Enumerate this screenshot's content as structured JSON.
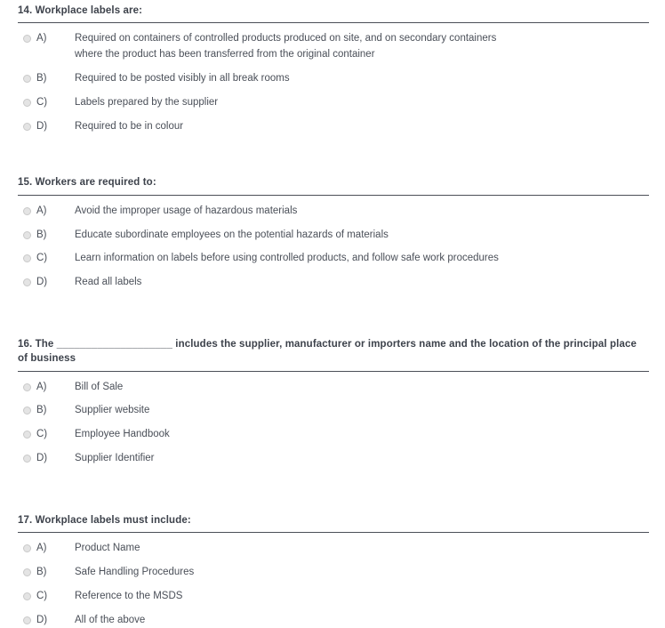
{
  "page": {
    "background": "#ffffff",
    "text_color": "#4a4f58",
    "heading_color": "#3d424b",
    "rule_color": "#4b4f57",
    "radio_fill": "#e4e4e4"
  },
  "questions": [
    {
      "number": "14.",
      "heading": "Workplace labels are:",
      "heading_full": "14.  Workplace labels are:",
      "options": [
        {
          "letter": "A)",
          "text": "Required on containers of controlled products produced on site, and on secondary containers",
          "text_line2": "where the product has been transferred from the original container"
        },
        {
          "letter": "B)",
          "text": "Required to be posted visibly in all break rooms",
          "text_line2": ""
        },
        {
          "letter": "C)",
          "text": "Labels prepared by the supplier",
          "text_line2": ""
        },
        {
          "letter": "D)",
          "text": "Required to be in colour",
          "text_line2": ""
        }
      ]
    },
    {
      "number": "15.",
      "heading": "Workers are required to:",
      "heading_full": "15.  Workers are required to:",
      "options": [
        {
          "letter": "A)",
          "text": "Avoid the improper usage of hazardous materials",
          "text_line2": ""
        },
        {
          "letter": "B)",
          "text": "Educate subordinate employees on the potential hazards of materials",
          "text_line2": ""
        },
        {
          "letter": "C)",
          "text": "Learn information on labels before using controlled products, and follow safe work procedures",
          "text_line2": ""
        },
        {
          "letter": "D)",
          "text": "Read all labels",
          "text_line2": ""
        }
      ]
    },
    {
      "number": "16.",
      "heading": "The ____________________ includes the supplier, manufacturer or importers name and the location of the principal place of business",
      "heading_full": "16.  The ____________________ includes the supplier, manufacturer or importers name and the location of the principal place of business",
      "options": [
        {
          "letter": "A)",
          "text": "Bill of Sale",
          "text_line2": ""
        },
        {
          "letter": "B)",
          "text": "Supplier website",
          "text_line2": ""
        },
        {
          "letter": "C)",
          "text": "Employee Handbook",
          "text_line2": ""
        },
        {
          "letter": "D)",
          "text": "Supplier Identifier",
          "text_line2": ""
        }
      ]
    },
    {
      "number": "17.",
      "heading": "Workplace labels must include:",
      "heading_full": "17.  Workplace labels must include:",
      "options": [
        {
          "letter": "A)",
          "text": "Product Name",
          "text_line2": ""
        },
        {
          "letter": "B)",
          "text": "Safe Handling Procedures",
          "text_line2": ""
        },
        {
          "letter": "C)",
          "text": "Reference to the MSDS",
          "text_line2": ""
        },
        {
          "letter": "D)",
          "text": "All of the above",
          "text_line2": ""
        }
      ]
    }
  ]
}
